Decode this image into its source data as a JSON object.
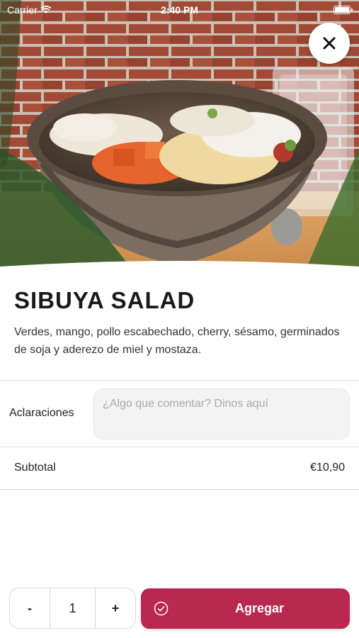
{
  "status_bar": {
    "carrier": "Carrier",
    "time": "2:40 PM"
  },
  "product": {
    "title": "SIBUYA SALAD",
    "description": "Verdes, mango, pollo escabechado, cherry, sésamo, germinados de soja y aderezo de miel y mostaza."
  },
  "clarifications": {
    "label": "Aclaraciones",
    "placeholder": "¿Algo que comentar? Dinos aquí",
    "value": ""
  },
  "subtotal": {
    "label": "Subtotal",
    "value": "€10,90"
  },
  "quantity": {
    "decrement_label": "-",
    "value": "1",
    "increment_label": "+"
  },
  "add_button": {
    "label": "Agregar"
  },
  "icons": {
    "close": "close-icon",
    "check": "check-circle-icon",
    "wifi": "wifi-icon",
    "battery": "battery-icon"
  },
  "colors": {
    "accent": "#b8284f",
    "input_bg": "#f3f3f3",
    "divider": "#dcdcdc"
  }
}
